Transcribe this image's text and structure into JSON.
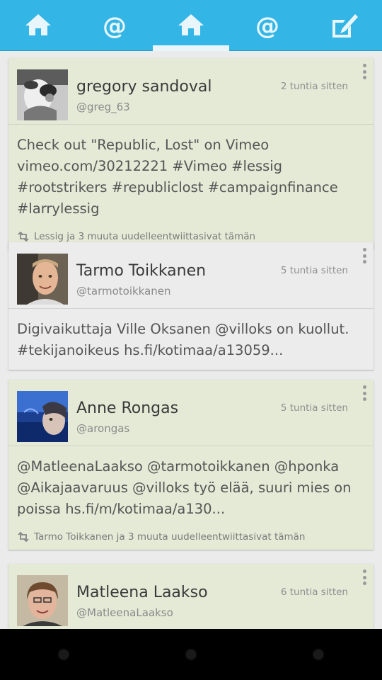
{
  "tabs": [
    {
      "icon": "home-icon",
      "active": false
    },
    {
      "icon": "mention-icon",
      "active": false
    },
    {
      "icon": "home-icon",
      "active": true
    },
    {
      "icon": "mention-icon",
      "active": false
    },
    {
      "icon": "compose-icon",
      "active": false
    }
  ],
  "tweets": [
    {
      "name": "gregory sandoval",
      "handle": "@greg_63",
      "time": "2 tuntia sitten",
      "text": "Check out \"Republic, Lost\" on Vimeo vimeo.com/30212221 #Vimeo #lessig #rootstrikers #republiclost #campaignfinance #larrylessig",
      "retweet": "Lessig ja 3 muuta uudelleentwiittasivat tämän"
    },
    {
      "name": "Tarmo Toikkanen",
      "handle": "@tarmotoikkanen",
      "time": "5 tuntia sitten",
      "text": "Digivaikuttaja Ville Oksanen @villoks on kuollut. #tekijanoikeus hs.fi/kotimaa/a13059...",
      "retweet": ""
    },
    {
      "name": "Anne Rongas",
      "handle": "@arongas",
      "time": "5 tuntia sitten",
      "text": "@MatleenaLaakso @tarmotoikkanen @hponka @Aikajaavaruus @villoks työ elää, suuri mies on poissa hs.fi/m/kotimaa/a130...",
      "retweet": "Tarmo Toikkanen ja 3 muuta uudelleentwiittasivat tämän"
    },
    {
      "name": "Matleena Laakso",
      "handle": "@MatleenaLaakso",
      "time": "6 tuntia sitten",
      "text": "",
      "retweet": ""
    }
  ]
}
